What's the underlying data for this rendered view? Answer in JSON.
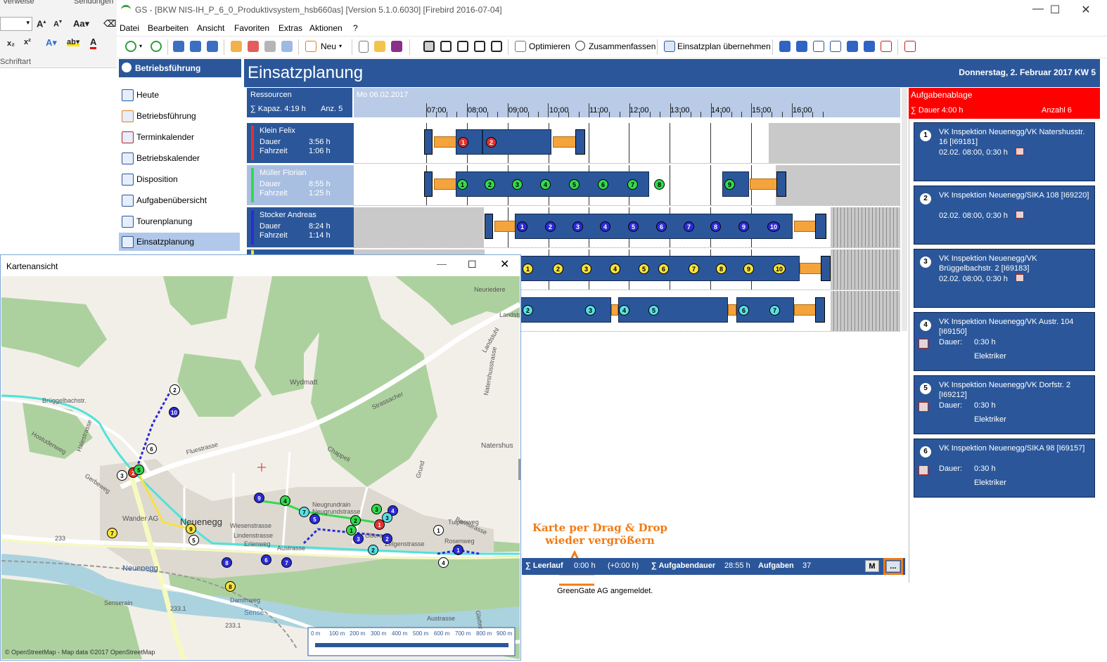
{
  "word": {
    "tabs": [
      "Verweise",
      "Sendungen"
    ],
    "group_label": "Schriftart"
  },
  "window": {
    "title": "GS - [BKW NIS-IH_P_6_0_Produktivsystem_hsb660as]  [Version  5.1.0.6030]  [Firebird 2016-07-04]",
    "menu": [
      "Datei",
      "Bearbeiten",
      "Ansicht",
      "Favoriten",
      "Extras",
      "Aktionen",
      "?"
    ],
    "toolbar": {
      "new_label": "Neu",
      "optimize_label": "Optimieren",
      "merge_label": "Zusammenfassen",
      "adopt_label": "Einsatzplan übernehmen"
    }
  },
  "sidebar": {
    "header": "Betriebsführung",
    "items": [
      "Heute",
      "Betriebsführung",
      "Terminkalender",
      "Betriebskalender",
      "Disposition",
      "Aufgabenübersicht",
      "Tourenplanung",
      "Einsatzplanung"
    ]
  },
  "planning": {
    "title": "Einsatzplanung",
    "date": "Donnerstag, 2. Februar 2017  KW 5",
    "resources_label": "Ressourcen",
    "capacity_label": "∑ Kapaz. 4:19 h",
    "count_label": "Anz. 5",
    "day_label": "Mo 06.02.2017",
    "hours": [
      "07:00",
      "08:00",
      "09:00",
      "10:00",
      "11:00",
      "12:00",
      "13:00",
      "14:00",
      "15:00",
      "16:00"
    ],
    "dur_label": "Dauer",
    "drive_label": "Fahrzeit",
    "resources": [
      {
        "name": "Klein Felix",
        "dauer": "3:56 h",
        "fahrzeit": "1:06 h",
        "color": "#e53030"
      },
      {
        "name": "Müller Florian",
        "dauer": "8:55 h",
        "fahrzeit": "1:25 h",
        "color": "#32d94e"
      },
      {
        "name": "Stocker Andreas",
        "dauer": "8:24 h",
        "fahrzeit": "1:14 h",
        "color": "#2b2bd8"
      }
    ]
  },
  "tasks": {
    "header": "Aufgabenablage",
    "duration": "∑ Dauer 4:00 h",
    "count": "Anzahl 6",
    "dur_label": "Dauer:",
    "items": [
      {
        "n": "1",
        "title": "VK Inspektion Neuenegg/VK Natershusstr. 16 [I69181]",
        "line": "02.02. 08:00, 0:30 h"
      },
      {
        "n": "2",
        "title": "VK Inspektion Neuenegg/SIKA 108 [I69220]",
        "line": "02.02. 08:00, 0:30 h"
      },
      {
        "n": "3",
        "title": "VK Inspektion Neuenegg/VK Brüggelbachstr. 2 [I69183]",
        "line": "02.02. 08:00, 0:30 h"
      },
      {
        "n": "4",
        "title": "VK Inspektion Neuenegg/VK Austr. 104 [I69150]",
        "dur": "0:30 h",
        "extra": "Elektriker"
      },
      {
        "n": "5",
        "title": "VK Inspektion Neuenegg/VK Dorfstr. 2 [I69212]",
        "dur": "0:30 h",
        "extra": "Elektriker"
      },
      {
        "n": "6",
        "title": "VK Inspektion Neuenegg/SIKA 98 [I69157]",
        "dur": "0:30 h",
        "extra": "Elektriker"
      }
    ]
  },
  "status": {
    "leerlauf_label": "∑ Leerlauf",
    "leerlauf_value": "0:00 h",
    "leerlauf_delta": "(+0:00 h)",
    "aufgabendauer_label": "∑ Aufgabendauer",
    "aufgabendauer_value": "28:55 h",
    "aufgaben_label": "Aufgaben",
    "aufgaben_value": "37",
    "m_button": "M",
    "more_button": "...",
    "footer": "GreenGate AG angemeldet."
  },
  "annotation": {
    "line1": "Karte per Drag &  Drop",
    "line2": "wieder vergrößern"
  },
  "map": {
    "title": "Kartenansicht",
    "labels": [
      "Neuriedere",
      "Landstuhl",
      "Landstuhl",
      "Wydmatt",
      "Strassacher",
      "Natershusstrasse",
      "Natershus",
      "Chappeli",
      "Fluestrasse",
      "Brüggelbachstr.",
      "Hostudenweg",
      "Halestrasse",
      "Gerbeweg",
      "Neuenegg",
      "Wander AG",
      "Wiesenstrasse",
      "Lindenstrasse",
      "Erlenweg",
      "Austrasse",
      "Neugrundrain",
      "Neugrundstrasse",
      "Obere",
      "Zelgenstrasse",
      "Rosenweg",
      "Tulpenweg",
      "Grund",
      "Bernstrasse",
      "Neuenegg",
      "Sense",
      "Senserain",
      "Dammweg",
      "Austrasse",
      "Gletter",
      "233",
      "233.1",
      "233.1"
    ],
    "scale": [
      "0 m",
      "100 m",
      "200 m",
      "300 m",
      "400 m",
      "500 m",
      "600 m",
      "700 m",
      "800 m",
      "900 m"
    ],
    "attribution": "© OpenStreetMap - Map data ©2017 OpenStreetMap"
  }
}
